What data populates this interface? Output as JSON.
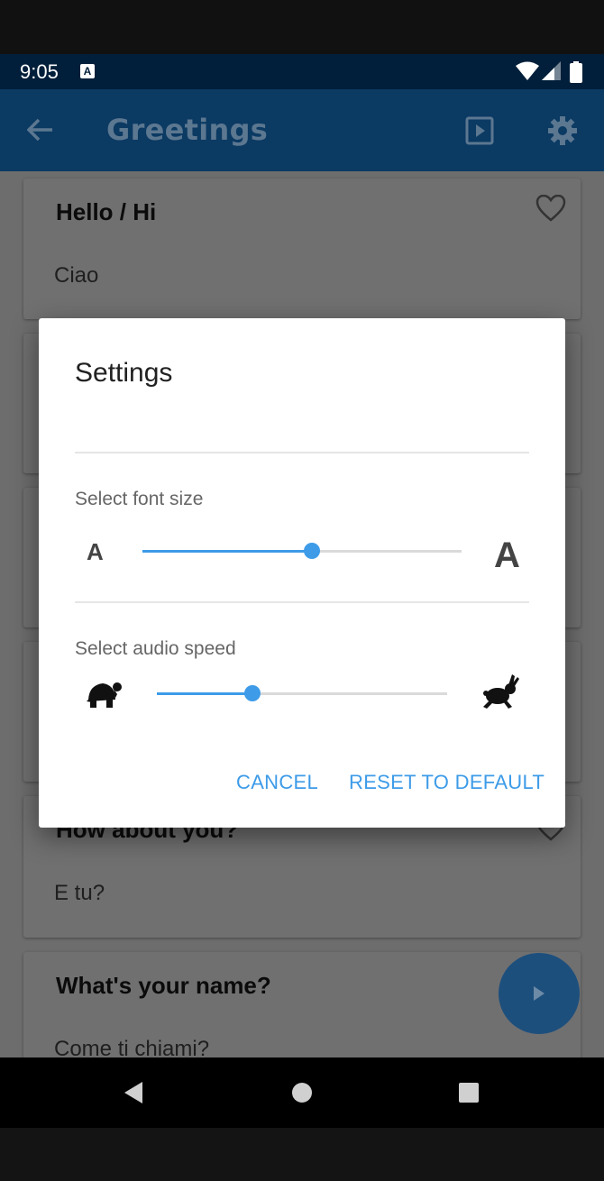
{
  "status_bar": {
    "time": "9:05",
    "notification_icon": "A"
  },
  "app_bar": {
    "title": "Greetings",
    "back_icon": "arrow-back-icon",
    "play_icon": "play-box-icon",
    "settings_icon": "gear-icon"
  },
  "cards": [
    {
      "english": "Hello / Hi",
      "italian": "Ciao"
    },
    {
      "english": "How about you?",
      "italian": "E tu?"
    },
    {
      "english": "What's your name?",
      "italian": "Come ti chiami?"
    }
  ],
  "dialog": {
    "title": "Settings",
    "font_size_label": "Select font size",
    "font_small_glyph": "A",
    "font_large_glyph": "A",
    "font_size_level": 0.53,
    "audio_speed_label": "Select audio speed",
    "audio_speed_level": 0.33,
    "cancel_label": "CANCEL",
    "reset_label": "RESET TO DEFAULT"
  },
  "colors": {
    "accent": "#3d9be8",
    "app_bar": "#0b3a63",
    "status_bar": "#011f3a"
  }
}
